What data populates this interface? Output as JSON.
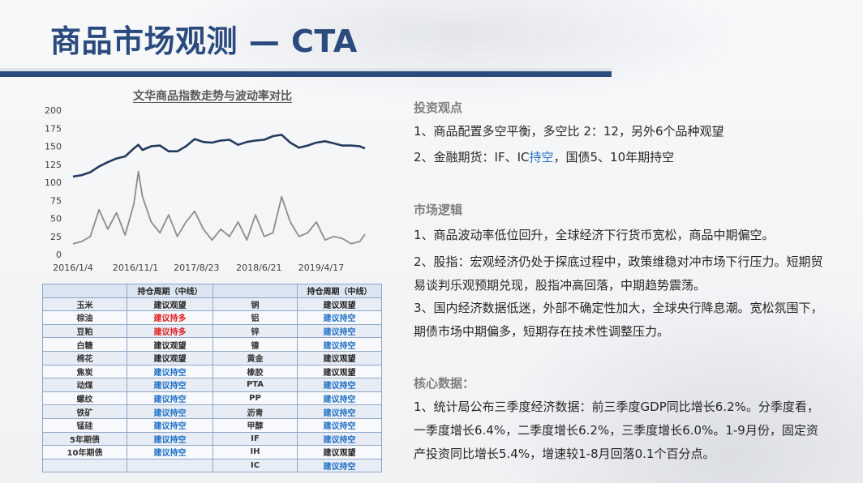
{
  "title": "商品市场观测 — CTA",
  "chart_data": {
    "type": "line",
    "title": "文华商品指数走势与波动率对比",
    "ylim": [
      0,
      200
    ],
    "y_ticks": [
      "200",
      "175",
      "150",
      "125",
      "100",
      "75",
      "50",
      "25",
      "0"
    ],
    "x_tick_labels": [
      "2016/1/4",
      "2016/11/1",
      "2017/8/23",
      "2018/6/21",
      "2019/4/17"
    ],
    "x_range": [
      "2016/1/4",
      "2019/11/15"
    ],
    "series": [
      {
        "color": "#243b5e",
        "points": [
          [
            "2016/1/4",
            108
          ],
          [
            "2016/2/15",
            110
          ],
          [
            "2016/3/28",
            114
          ],
          [
            "2016/5/9",
            122
          ],
          [
            "2016/6/20",
            128
          ],
          [
            "2016/8/1",
            133
          ],
          [
            "2016/9/12",
            136
          ],
          [
            "2016/10/24",
            147
          ],
          [
            "2016/11/15",
            152
          ],
          [
            "2016/12/5",
            145
          ],
          [
            "2017/1/16",
            150
          ],
          [
            "2017/2/27",
            151
          ],
          [
            "2017/4/10",
            143
          ],
          [
            "2017/5/22",
            143
          ],
          [
            "2017/7/3",
            150
          ],
          [
            "2017/8/14",
            160
          ],
          [
            "2017/9/25",
            156
          ],
          [
            "2017/11/6",
            155
          ],
          [
            "2017/12/18",
            158
          ],
          [
            "2018/1/29",
            159
          ],
          [
            "2018/3/12",
            152
          ],
          [
            "2018/4/23",
            156
          ],
          [
            "2018/6/4",
            158
          ],
          [
            "2018/7/16",
            159
          ],
          [
            "2018/8/27",
            164
          ],
          [
            "2018/10/8",
            166
          ],
          [
            "2018/11/19",
            155
          ],
          [
            "2018/12/31",
            148
          ],
          [
            "2019/2/11",
            151
          ],
          [
            "2019/3/25",
            155
          ],
          [
            "2019/5/6",
            157
          ],
          [
            "2019/6/17",
            154
          ],
          [
            "2019/7/29",
            151
          ],
          [
            "2019/9/9",
            151
          ],
          [
            "2019/10/21",
            150
          ],
          [
            "2019/11/15",
            147
          ]
        ]
      },
      {
        "color": "#8c8c8c",
        "points": [
          [
            "2016/1/4",
            15
          ],
          [
            "2016/2/15",
            18
          ],
          [
            "2016/3/28",
            25
          ],
          [
            "2016/5/9",
            62
          ],
          [
            "2016/6/20",
            35
          ],
          [
            "2016/8/1",
            58
          ],
          [
            "2016/9/12",
            27
          ],
          [
            "2016/10/24",
            70
          ],
          [
            "2016/11/15",
            115
          ],
          [
            "2016/12/5",
            80
          ],
          [
            "2017/1/16",
            45
          ],
          [
            "2017/2/27",
            30
          ],
          [
            "2017/4/10",
            55
          ],
          [
            "2017/5/22",
            25
          ],
          [
            "2017/7/3",
            45
          ],
          [
            "2017/8/14",
            60
          ],
          [
            "2017/9/25",
            35
          ],
          [
            "2017/11/6",
            20
          ],
          [
            "2017/12/18",
            35
          ],
          [
            "2018/1/29",
            25
          ],
          [
            "2018/3/12",
            45
          ],
          [
            "2018/4/23",
            20
          ],
          [
            "2018/6/4",
            55
          ],
          [
            "2018/7/16",
            25
          ],
          [
            "2018/8/27",
            30
          ],
          [
            "2018/10/8",
            80
          ],
          [
            "2018/11/19",
            45
          ],
          [
            "2018/12/31",
            25
          ],
          [
            "2019/2/11",
            30
          ],
          [
            "2019/3/25",
            45
          ],
          [
            "2019/5/6",
            20
          ],
          [
            "2019/6/17",
            25
          ],
          [
            "2019/7/29",
            22
          ],
          [
            "2019/9/9",
            15
          ],
          [
            "2019/10/21",
            18
          ],
          [
            "2019/11/15",
            28
          ]
        ]
      }
    ]
  },
  "table": {
    "headers": [
      "",
      "持仓周期（中线）",
      "",
      "持仓周期（中线）"
    ],
    "rows": [
      [
        "玉米",
        "建议观望",
        "铜",
        "建议观望"
      ],
      [
        "棕油",
        "建议持多",
        "铝",
        "建议持空"
      ],
      [
        "豆粕",
        "建议持多",
        "锌",
        "建议持空"
      ],
      [
        "白糖",
        "建议观望",
        "镍",
        "建议持空"
      ],
      [
        "棉花",
        "建议观望",
        "黄金",
        "建议观望"
      ],
      [
        "焦炭",
        "建议持空",
        "橡胶",
        "建议观望"
      ],
      [
        "动煤",
        "建议持空",
        "PTA",
        "建议持空"
      ],
      [
        "螺纹",
        "建议持空",
        "PP",
        "建议持空"
      ],
      [
        "铁矿",
        "建议持空",
        "沥青",
        "建议持空"
      ],
      [
        "锰硅",
        "建议持空",
        "甲醇",
        "建议持空"
      ],
      [
        "5年期债",
        "建议持空",
        "IF",
        "建议持空"
      ],
      [
        "10年期债",
        "建议持空",
        "IH",
        "建议观望"
      ],
      [
        "",
        "",
        "IC",
        "建议持空"
      ]
    ]
  },
  "sections": {
    "view_title": "投资观点",
    "view_1": "1、商品配置多空平衡，多空比 2：12，另外6个品种观望",
    "view_2_pre": "2、金融期货：IF、IC",
    "view_2_hl": "持空",
    "view_2_post": "，国债5、10年期持空",
    "logic_title": "市场逻辑",
    "logic_1": "1、商品波动率低位回升，全球经济下行货币宽松，商品中期偏空。",
    "logic_2": "2、股指：宏观经济仍处于探底过程中，政策维稳对冲市场下行压力。短期贸易谈判乐观预期兑现，股指冲高回落，中期趋势震荡。",
    "logic_3": "3、国内经济数据低迷，外部不确定性加大，全球央行降息潮。宽松氛围下，期债市场中期偏多，短期存在技术性调整压力。",
    "core_title": "核心数据：",
    "core_1": "1、统计局公布三季度经济数据：前三季度GDP同比增长6.2%。分季度看，一季度增长6.4%，二季度增长6.2%，三季度增长6.0%。1-9月份，固定资产投资同比增长5.4%，增速较1-8月回落0.1个百分点。"
  },
  "colors": {
    "brand": "#2b4a7e",
    "short": "#1f6fc6",
    "long": "#e02020"
  }
}
